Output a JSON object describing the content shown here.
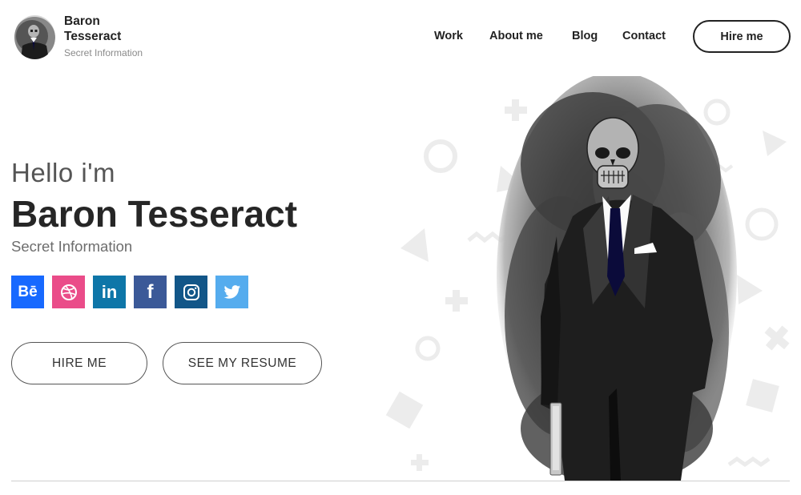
{
  "brand": {
    "name": "Baron Tesseract",
    "subtitle": "Secret Information"
  },
  "nav": {
    "items": [
      {
        "label": "Work"
      },
      {
        "label": "About me"
      },
      {
        "label": "Blog"
      },
      {
        "label": "Contact"
      }
    ],
    "hire_label": "Hire me"
  },
  "hero": {
    "greeting": "Hello i'm",
    "name": "Baron Tesseract",
    "subtitle": "Secret Information",
    "hire_button": "HIRE ME",
    "resume_button": "SEE MY RESUME"
  },
  "socials": [
    {
      "name": "behance-icon",
      "label": "Bē",
      "color": "#1769ff"
    },
    {
      "name": "dribbble-icon",
      "label": "",
      "color": "#ea4c89"
    },
    {
      "name": "linkedin-icon",
      "label": "in",
      "color": "#0e76a8"
    },
    {
      "name": "facebook-icon",
      "label": "f",
      "color": "#3b5998"
    },
    {
      "name": "instagram-icon",
      "label": "",
      "color": "#125688"
    },
    {
      "name": "twitter-icon",
      "label": "",
      "color": "#55acee"
    }
  ]
}
